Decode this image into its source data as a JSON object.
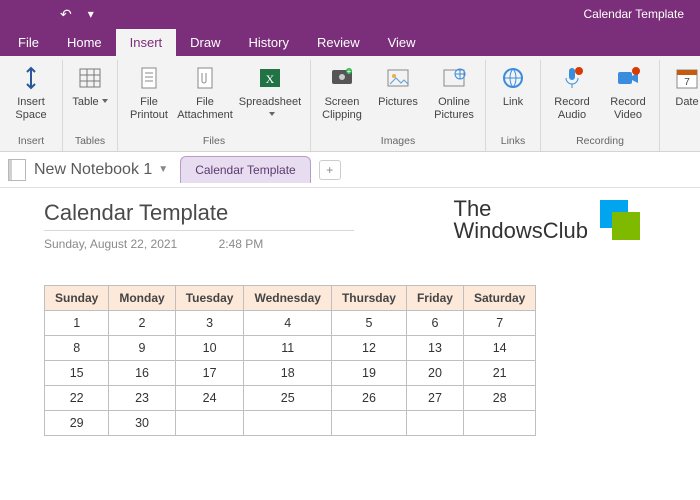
{
  "titlebar": {
    "doc": "Calendar Template"
  },
  "tabs": {
    "file": "File",
    "home": "Home",
    "insert": "Insert",
    "draw": "Draw",
    "history": "History",
    "review": "Review",
    "view": "View",
    "active": "insert"
  },
  "ribbon": {
    "groups": [
      {
        "label": "Insert",
        "items": [
          {
            "id": "insert-space",
            "l1": "Insert",
            "l2": "Space"
          }
        ]
      },
      {
        "label": "Tables",
        "items": [
          {
            "id": "table",
            "l1": "Table",
            "drop": true
          }
        ]
      },
      {
        "label": "Files",
        "items": [
          {
            "id": "file-printout",
            "l1": "File",
            "l2": "Printout"
          },
          {
            "id": "file-attach",
            "l1": "File",
            "l2": "Attachment"
          },
          {
            "id": "spreadsheet",
            "l1": "Spreadsheet",
            "drop": true
          }
        ]
      },
      {
        "label": "Images",
        "items": [
          {
            "id": "screen-clipping",
            "l1": "Screen",
            "l2": "Clipping"
          },
          {
            "id": "pictures",
            "l1": "Pictures"
          },
          {
            "id": "online-pictures",
            "l1": "Online",
            "l2": "Pictures"
          }
        ]
      },
      {
        "label": "Links",
        "items": [
          {
            "id": "link",
            "l1": "Link"
          }
        ]
      },
      {
        "label": "Recording",
        "items": [
          {
            "id": "record-audio",
            "l1": "Record",
            "l2": "Audio"
          },
          {
            "id": "record-video",
            "l1": "Record",
            "l2": "Video"
          }
        ]
      },
      {
        "label": "",
        "items": [
          {
            "id": "date",
            "l1": "Date"
          }
        ]
      }
    ]
  },
  "nb": {
    "name": "New Notebook 1",
    "page": "Calendar Template",
    "add": "+"
  },
  "content": {
    "title": "Calendar Template",
    "date": "Sunday, August 22, 2021",
    "time": "2:48 PM",
    "brand": {
      "l1": "The",
      "l2": "WindowsClub"
    },
    "headers": [
      "Sunday",
      "Monday",
      "Tuesday",
      "Wednesday",
      "Thursday",
      "Friday",
      "Saturday"
    ],
    "rows": [
      [
        "1",
        "2",
        "3",
        "4",
        "5",
        "6",
        "7"
      ],
      [
        "8",
        "9",
        "10",
        "11",
        "12",
        "13",
        "14"
      ],
      [
        "15",
        "16",
        "17",
        "18",
        "19",
        "20",
        "21"
      ],
      [
        "22",
        "23",
        "24",
        "25",
        "26",
        "27",
        "28"
      ],
      [
        "29",
        "30",
        "",
        "",
        "",
        "",
        ""
      ]
    ]
  }
}
